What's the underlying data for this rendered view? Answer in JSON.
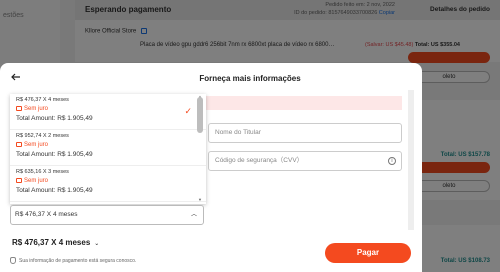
{
  "background": {
    "sidebar_items": [
      "estões"
    ],
    "orders": [
      {
        "status": "Esperando pagamento",
        "order_date": "Pedido feito em: 2 nov, 2022",
        "order_id": "ID do pedido: 8157649033700826",
        "copy_label": "Copiar",
        "details_label": "Detalhes do pedido",
        "store": "Kllore Official Store",
        "product": "Placa de vídeo gpu gddr6 256bit 7nm rx 6800xt placa de vídeo rx 6800…",
        "old_price": "(Salvar: US $45.48)",
        "total": "Total: US $355.04",
        "outline_label": "oleto"
      },
      {
        "total": "Total: US $157.78",
        "outline_label": "oleto"
      },
      {
        "total": "Total: US $108.73"
      }
    ]
  },
  "modal": {
    "title": "Forneça mais informações",
    "name_placeholder": "Nome do Titular",
    "cvv_placeholder": "Código de segurança（CVV）",
    "installments": [
      {
        "price": "R$ 476,37 X 4 meses",
        "interest": "Sem juro",
        "total": "Total Amount: R$ 1.905,49",
        "selected": true
      },
      {
        "price": "R$ 952,74 X 2 meses",
        "interest": "Sem juro",
        "total": "Total Amount: R$ 1.905,49",
        "selected": false
      },
      {
        "price": "R$ 635,16 X 3 meses",
        "interest": "Sem juro",
        "total": "Total Amount: R$ 1.905,49",
        "selected": false
      }
    ],
    "selected_value": "R$ 476,37 X 4 meses",
    "footer_amount": "R$ 476,37 X 4 meses",
    "pay_label": "Pagar",
    "secure_text": "Sua informação de pagamento está segura conosco."
  },
  "colors": {
    "accent": "#f44a1f",
    "pink_notice": "#fde7e7"
  },
  "icons": [
    "back-arrow-icon",
    "close-icon",
    "check-icon",
    "info-icon",
    "chevron-down-icon",
    "chevron-up-icon",
    "shield-icon",
    "store-chat-icon"
  ]
}
